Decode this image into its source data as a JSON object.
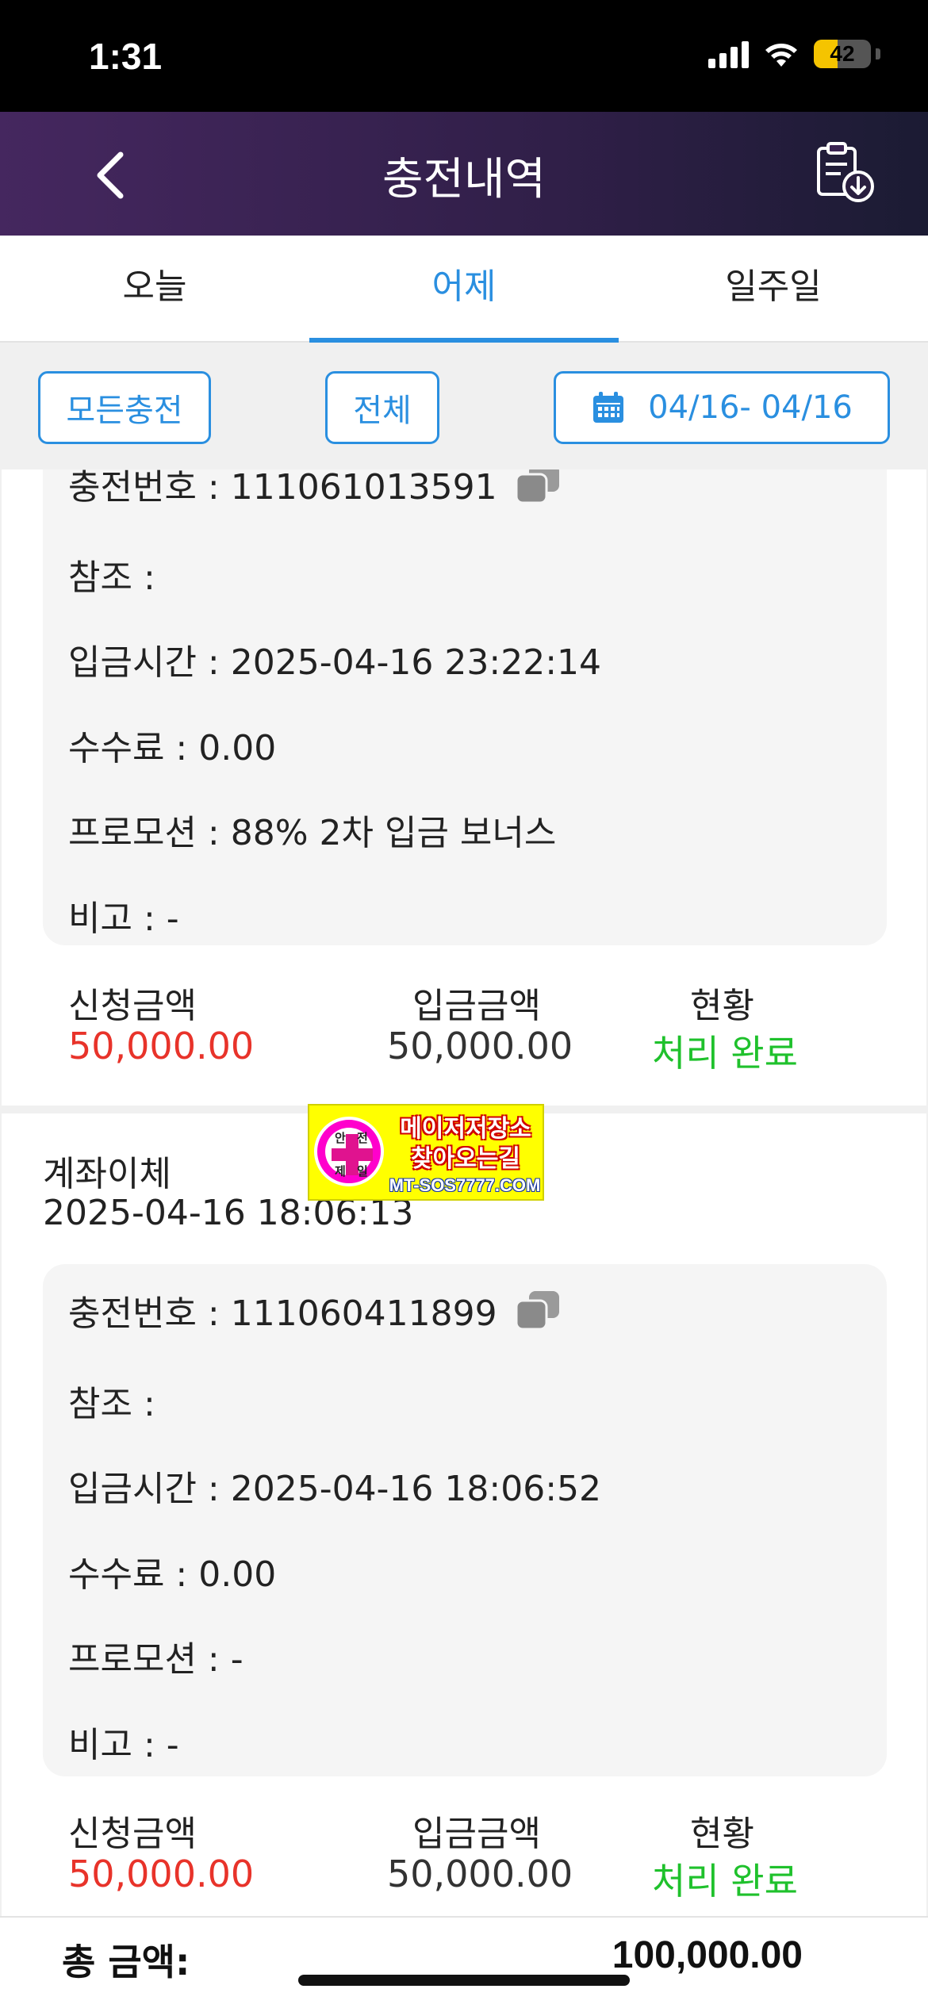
{
  "status": {
    "time": "1:31",
    "battery": "42",
    "battery_level": 0.42
  },
  "header": {
    "title": "충전내역",
    "back_icon": "chevron-left-icon",
    "export_icon": "clipboard-download-icon"
  },
  "tabs": [
    {
      "label": "오늘",
      "active": false
    },
    {
      "label": "어제",
      "active": true
    },
    {
      "label": "일주일",
      "active": false
    }
  ],
  "filters": {
    "type_label": "모든충전",
    "status_label": "전체",
    "date_range": "04/16- 04/16"
  },
  "records": [
    {
      "details": {
        "charge_no": "충전번호 : 111061013591",
        "reference": "참조 :",
        "deposit_time": "입금시간 : 2025-04-16 23:22:14",
        "fee": "수수료 : 0.00",
        "promotion": "프로모션 : 88% 2차 입금 보너스",
        "note": "비고 : -"
      },
      "summary": {
        "request_label": "신청금액",
        "request_value": "50,000.00",
        "deposit_label": "입금금액",
        "deposit_value": "50,000.00",
        "status_label": "현황",
        "status_value": "처리 완료"
      }
    },
    {
      "method": "계좌이체",
      "datetime": "2025-04-16 18:06:13",
      "details": {
        "charge_no": "충전번호 : 111060411899",
        "reference": "참조 :",
        "deposit_time": "입금시간 : 2025-04-16 18:06:52",
        "fee": "수수료 : 0.00",
        "promotion": "프로모션 : -",
        "note": "비고 : -"
      },
      "summary": {
        "request_label": "신청금액",
        "request_value": "50,000.00",
        "deposit_label": "입금금액",
        "deposit_value": "50,000.00",
        "status_label": "현황",
        "status_value": "처리 완료"
      }
    }
  ],
  "banner": {
    "logo_chars": [
      "안",
      "전",
      "제",
      "일"
    ],
    "line1": "메이저저장소",
    "line2": "찾아오는길",
    "url": "MT-SOS7777.COM"
  },
  "total": {
    "label": "총 금액:",
    "value": "100,000.00"
  },
  "colors": {
    "accent": "#2a8fe0",
    "request_amount": "#e8332a",
    "status_done": "#1fc12c",
    "header_bg": "#45275f"
  }
}
